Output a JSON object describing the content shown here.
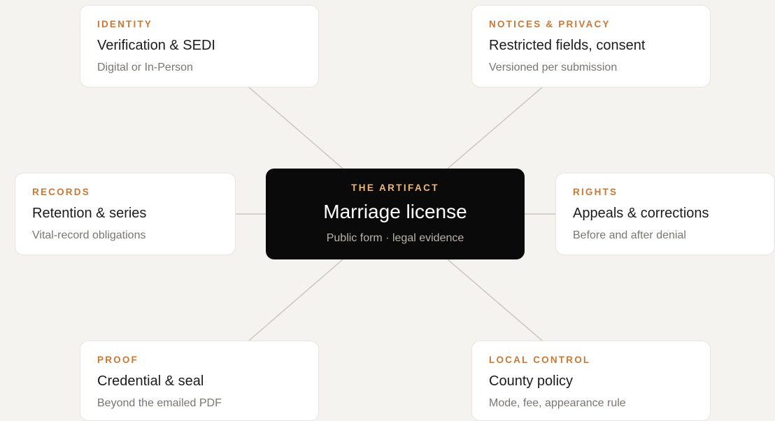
{
  "colors": {
    "background": "#f5f3ef",
    "card": "#ffffff",
    "accent": "#c8793a",
    "center_bg": "#0a0a0a",
    "center_accent": "#e9b77a",
    "connector": "#c9c4bc"
  },
  "center": {
    "eyebrow": "THE ARTIFACT",
    "title": "Marriage license",
    "subtitle": "Public form · legal evidence"
  },
  "cards": {
    "identity": {
      "eyebrow": "IDENTITY",
      "title": "Verification & SEDI",
      "subtitle": "Digital or In-Person"
    },
    "notices": {
      "eyebrow": "NOTICES & PRIVACY",
      "title": "Restricted fields, consent",
      "subtitle": "Versioned per submission"
    },
    "records": {
      "eyebrow": "RECORDS",
      "title": "Retention & series",
      "subtitle": "Vital-record obligations"
    },
    "rights": {
      "eyebrow": "RIGHTS",
      "title": "Appeals & corrections",
      "subtitle": "Before and after denial"
    },
    "proof": {
      "eyebrow": "PROOF",
      "title": "Credential & seal",
      "subtitle": "Beyond the emailed PDF"
    },
    "local": {
      "eyebrow": "LOCAL CONTROL",
      "title": "County policy",
      "subtitle": "Mode, fee, appearance rule"
    }
  }
}
